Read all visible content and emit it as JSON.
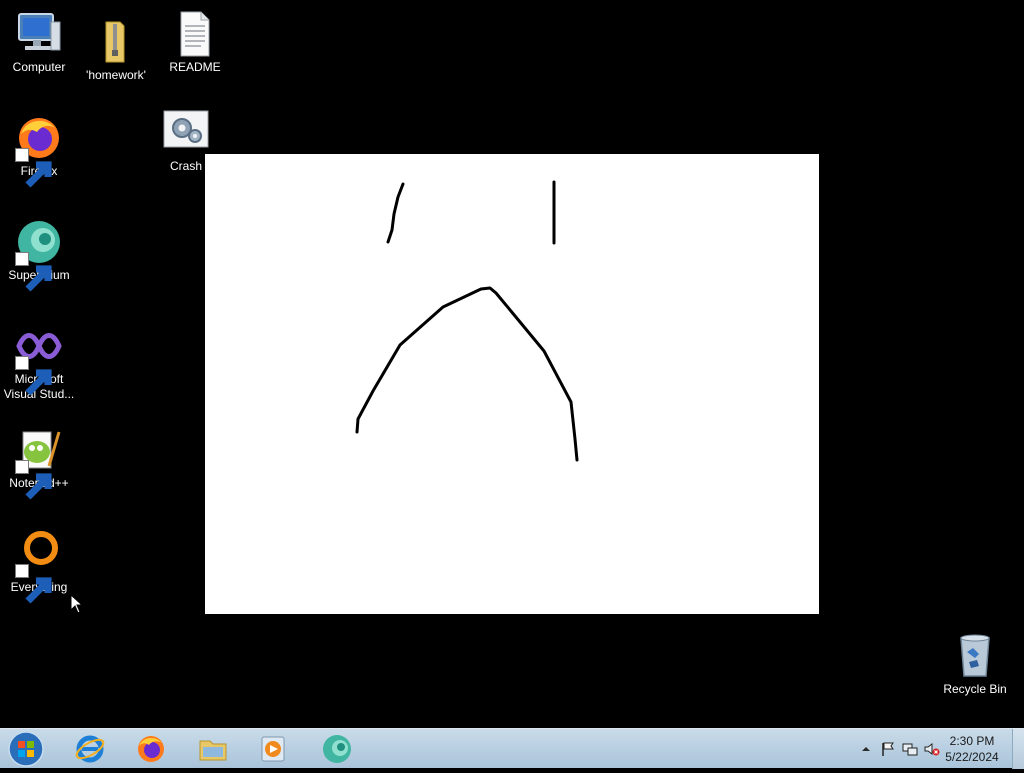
{
  "desktop": {
    "background_color": "#000000",
    "icons": [
      {
        "label": "Computer",
        "icon": "computer-icon"
      },
      {
        "label": "'homework'",
        "icon": "zip-folder-icon"
      },
      {
        "label": "README",
        "icon": "text-document-icon"
      },
      {
        "label": "Firefox",
        "icon": "firefox-icon",
        "shortcut": true
      },
      {
        "label": "Crash",
        "icon": "settings-gear-icon"
      },
      {
        "label": "Supermium",
        "icon": "supermium-icon",
        "shortcut": true
      },
      {
        "label": "Microsoft Visual Stud...",
        "icon": "visual-studio-icon",
        "shortcut": true
      },
      {
        "label": "Notepad++",
        "icon": "notepadpp-icon",
        "shortcut": true
      },
      {
        "label": "Everything",
        "icon": "everything-icon",
        "shortcut": true
      },
      {
        "label": "Recycle Bin",
        "icon": "recycle-bin-icon"
      }
    ]
  },
  "canvas": {
    "background": "#ffffff",
    "stroke_color": "#000000"
  },
  "taskbar": {
    "pinned": [
      {
        "name": "internet-explorer",
        "icon": "ie-icon"
      },
      {
        "name": "firefox",
        "icon": "firefox-icon"
      },
      {
        "name": "file-explorer",
        "icon": "folder-icon"
      },
      {
        "name": "media-player",
        "icon": "media-player-icon"
      },
      {
        "name": "supermium",
        "icon": "supermium-icon"
      }
    ],
    "clock": {
      "time": "2:30 PM",
      "date": "5/22/2024"
    }
  }
}
